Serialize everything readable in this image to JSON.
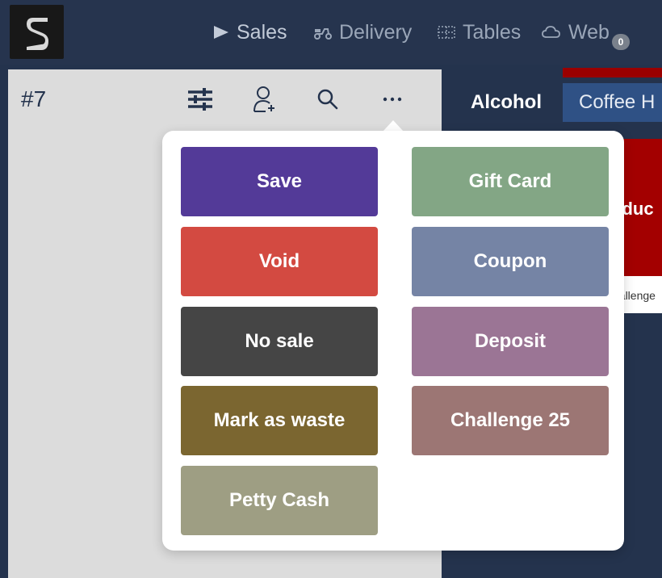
{
  "nav": {
    "items": [
      {
        "label": "Sales",
        "icon": "play-icon"
      },
      {
        "label": "Delivery",
        "icon": "scooter-icon"
      },
      {
        "label": "Tables",
        "icon": "tables-icon"
      },
      {
        "label": "Web",
        "icon": "cloud-icon"
      }
    ],
    "web_badge": "0"
  },
  "order": {
    "number": "#7",
    "toolbar": [
      "sliders-icon",
      "add-customer-icon",
      "search-icon",
      "more-icon"
    ]
  },
  "catalog": {
    "tabs": [
      {
        "label": "Alcohol",
        "active": true
      },
      {
        "label": "Coffee H",
        "active": false
      }
    ],
    "product_card": {
      "title": "oduc",
      "subtitle": "hallenge"
    }
  },
  "actions_menu": {
    "buttons": [
      {
        "label": "Save",
        "color": "#533a98"
      },
      {
        "label": "Gift Card",
        "color": "#83a685"
      },
      {
        "label": "Void",
        "color": "#d34a41"
      },
      {
        "label": "Coupon",
        "color": "#7584a5"
      },
      {
        "label": "No sale",
        "color": "#454545"
      },
      {
        "label": "Deposit",
        "color": "#9b7595"
      },
      {
        "label": "Mark as waste",
        "color": "#7b6630"
      },
      {
        "label": "Challenge 25",
        "color": "#9c7674"
      },
      {
        "label": "Petty Cash",
        "color": "#9e9e83"
      }
    ]
  }
}
